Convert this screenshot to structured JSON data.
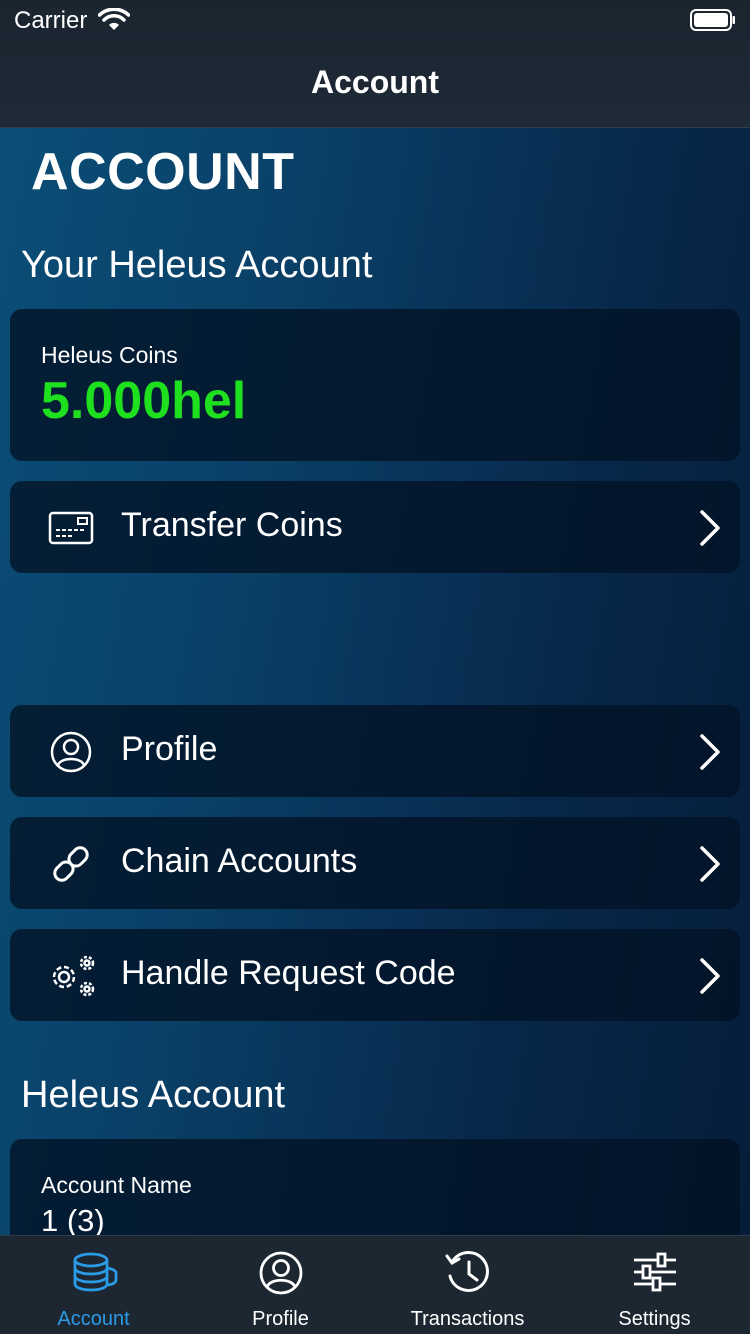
{
  "status": {
    "carrier": "Carrier"
  },
  "nav": {
    "title": "Account"
  },
  "page": {
    "heading": "ACCOUNT"
  },
  "sections": {
    "your_account": "Your Heleus Account",
    "heleus_account": "Heleus Account"
  },
  "coins": {
    "label": "Heleus Coins",
    "value": "5.000hel",
    "value_color": "#1fe01f"
  },
  "rows": {
    "transfer": {
      "label": "Transfer Coins",
      "icon": "card-icon"
    },
    "profile": {
      "label": "Profile",
      "icon": "user-circle-icon"
    },
    "chain": {
      "label": "Chain Accounts",
      "icon": "link-icon"
    },
    "request": {
      "label": "Handle Request Code",
      "icon": "gears-icon"
    }
  },
  "account_name": {
    "label": "Account Name",
    "value": "1 (3)"
  },
  "tabs": [
    {
      "label": "Account",
      "icon": "coins-stack-icon",
      "active": true
    },
    {
      "label": "Profile",
      "icon": "user-circle-icon",
      "active": false
    },
    {
      "label": "Transactions",
      "icon": "history-icon",
      "active": false
    },
    {
      "label": "Settings",
      "icon": "sliders-icon",
      "active": false
    }
  ],
  "colors": {
    "accent": "#2a9be6",
    "card_bg": "#021224"
  }
}
